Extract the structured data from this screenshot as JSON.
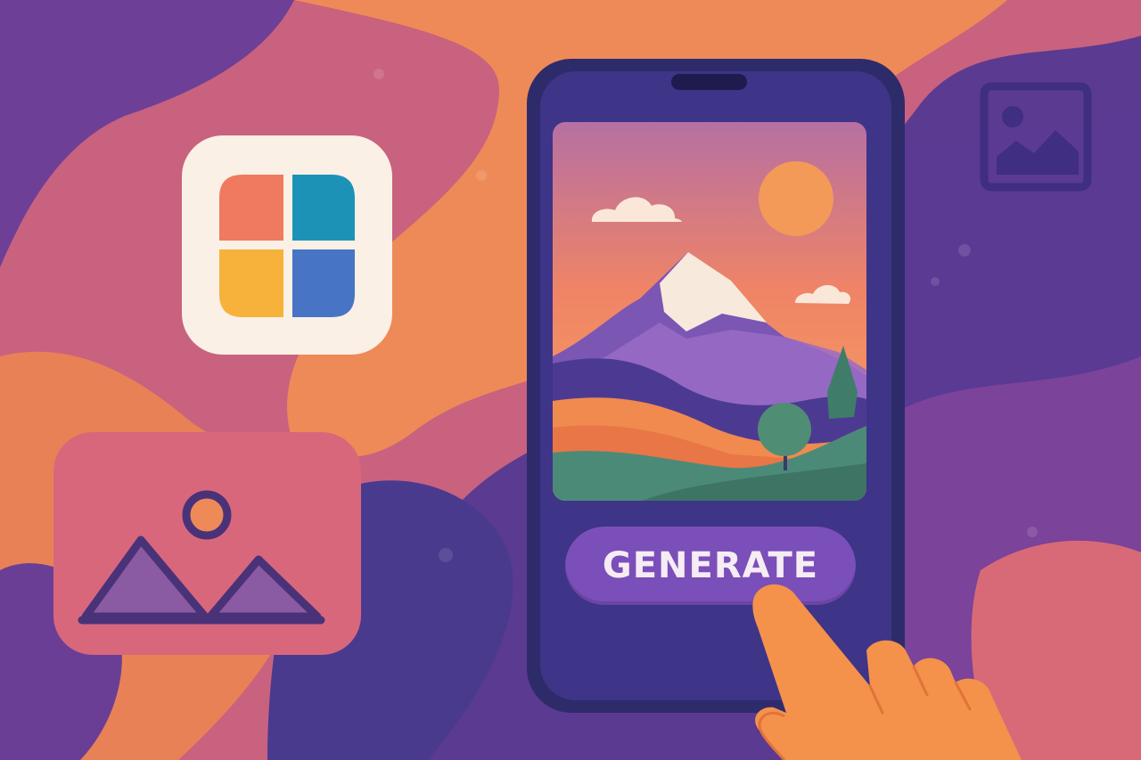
{
  "phone": {
    "generate_label": "GENERATE"
  },
  "colors": {
    "background_purple": "#5b3a91",
    "background_pink": "#c9627e",
    "background_orange": "#ee8a57",
    "phone_body": "#2e2b6b",
    "phone_screen": "#3e3488",
    "button": "#7b4fb9",
    "button_text": "#f6ecf4",
    "hand": "#f4914b",
    "sun": "#f39a59",
    "app_icon_tiles": [
      "#ef7a5f",
      "#1c93b6",
      "#f6b23a",
      "#4774c4"
    ]
  },
  "icons": [
    "app-grid-icon",
    "image-placeholder-icon",
    "picture-frame-icon",
    "pointing-hand"
  ]
}
